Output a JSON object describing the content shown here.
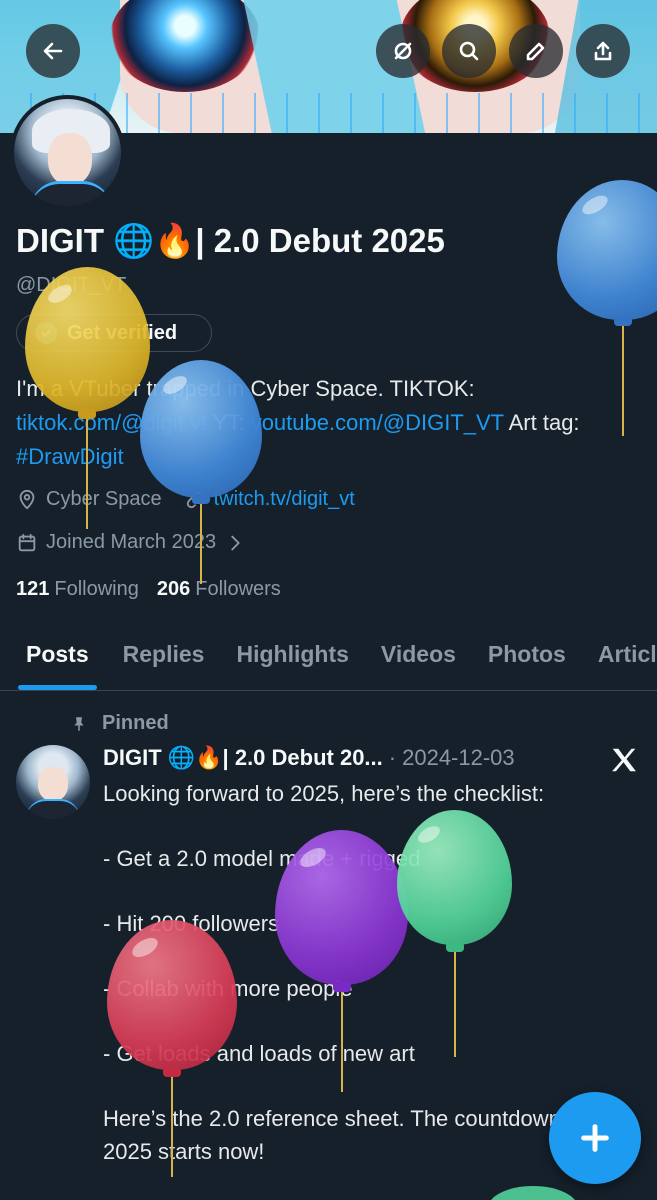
{
  "header": {
    "back_icon": "arrow-left-icon",
    "actions": [
      "grok-icon",
      "search-icon",
      "edit-icon",
      "share-icon"
    ]
  },
  "profile": {
    "name": "DIGIT 🌐🔥| 2.0 Debut 2025",
    "handle": "@DIGIT_VT",
    "verify_label": "Get verified",
    "bio": {
      "text1": "I'm a VTuber trapped in Cyber Space. TIKTOK: ",
      "link1": "tiktok.com/@digit.vt",
      "text2": " YT: ",
      "link2": "youtube.com/@DIGIT_VT",
      "text3": " Art tag: ",
      "link3": "#DrawDigit"
    },
    "location": "Cyber Space",
    "website": "twitch.tv/digit_vt",
    "joined": "Joined March 2023",
    "following_count": "121",
    "following_label": "Following",
    "followers_count": "206",
    "followers_label": "Followers"
  },
  "tabs": [
    "Posts",
    "Replies",
    "Highlights",
    "Videos",
    "Photos",
    "Articles"
  ],
  "post": {
    "pinned_label": "Pinned",
    "author": "DIGIT 🌐🔥| 2.0 Debut 20...",
    "separator": "·",
    "date": "2024-12-03",
    "lines": [
      "Looking forward to 2025, here’s the checklist:",
      "",
      "- Get a 2.0 model made + rigged",
      "",
      "- Hit 200 followers",
      "",
      "- Collab with more people",
      "",
      "- Get loads and loads of new art",
      "",
      "Here’s the 2.0 reference sheet. The countdown to 2025 starts now!"
    ]
  },
  "colors": {
    "background": "#15202b",
    "accent": "#1d9bf0",
    "muted": "#8b98a5"
  }
}
